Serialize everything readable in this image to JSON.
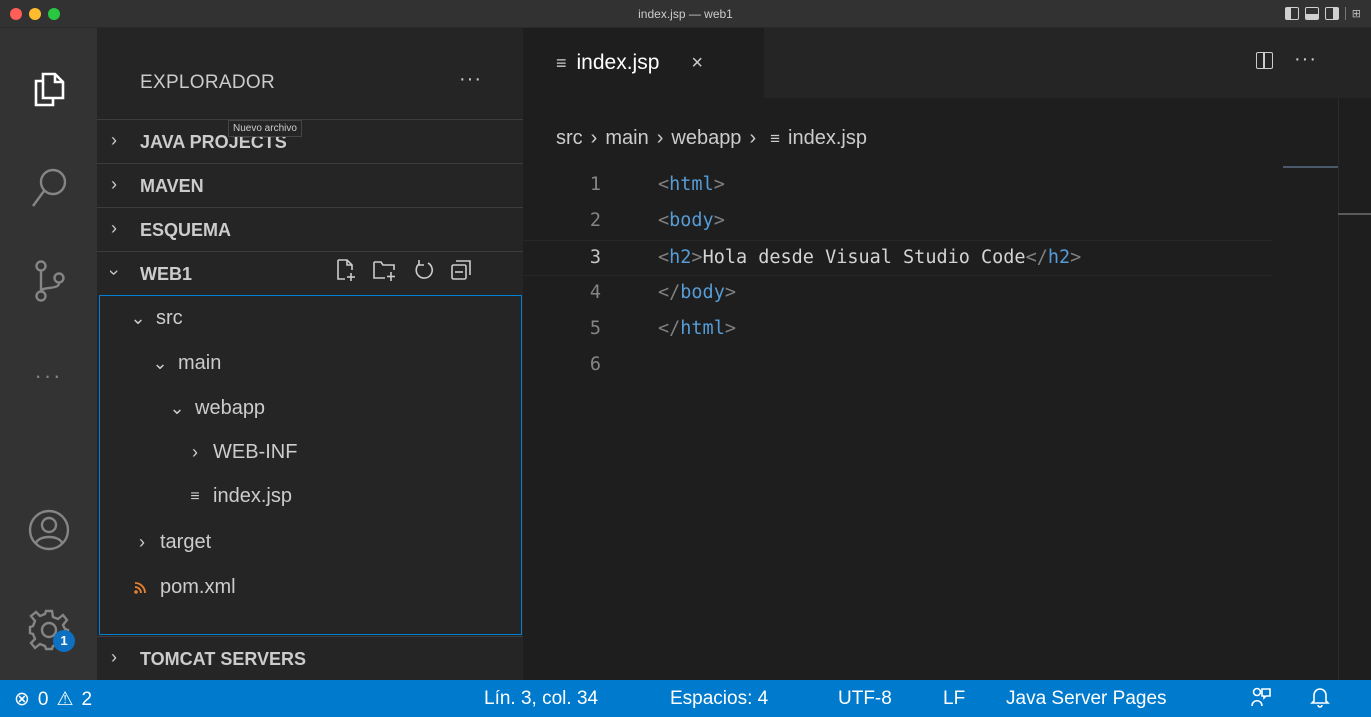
{
  "window": {
    "title": "index.jsp — web1"
  },
  "activity_bar": {
    "items": [
      "explorer",
      "search",
      "source-control",
      "more",
      "accounts",
      "manage"
    ],
    "more_label": "···",
    "manage_badge": "1"
  },
  "sidebar": {
    "header": "EXPLORADOR",
    "header_more": "···",
    "tooltip": "Nuevo archivo",
    "sections": {
      "java_projects": "JAVA PROJECTS",
      "maven": "MAVEN",
      "esquema": "ESQUEMA",
      "web1": "WEB1",
      "tomcat": "TOMCAT SERVERS"
    },
    "tree": {
      "src": "src",
      "main": "main",
      "webapp": "webapp",
      "web_inf": "WEB-INF",
      "index_jsp": "index.jsp",
      "target": "target",
      "pom": "pom.xml"
    }
  },
  "editor": {
    "tab_label": "index.jsp",
    "tab_close": "×",
    "more": "···",
    "breadcrumb": {
      "src": "src",
      "main": "main",
      "webapp": "webapp",
      "file": "index.jsp"
    },
    "lines": {
      "n1": "1",
      "n2": "2",
      "n3": "3",
      "n4": "4",
      "n5": "5",
      "n6": "6",
      "l1_tag": "html",
      "l2_tag": "body",
      "l3_open": "h2",
      "l3_text": "Hola desde Visual Studio Code",
      "l3_close": "h2",
      "l4_tag": "body",
      "l5_tag": "html"
    }
  },
  "statusbar": {
    "errors": "0",
    "warnings": "2",
    "position": "Lín. 3, col. 34",
    "spaces": "Espacios: 4",
    "encoding": "UTF-8",
    "eol": "LF",
    "language": "Java Server Pages"
  },
  "colors": {
    "accent": "#007acc",
    "tag_name": "#569cd6",
    "feed_icon": "#e8812d"
  }
}
